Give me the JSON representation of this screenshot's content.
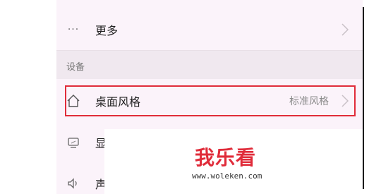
{
  "menu": {
    "more": {
      "icon": "more-dots-icon",
      "label": "更多",
      "dots": "···"
    },
    "section_device": "设备",
    "desktop_style": {
      "icon": "home-icon",
      "label": "桌面风格",
      "value": "标准风格"
    },
    "display": {
      "icon": "display-icon",
      "label": "显"
    },
    "sound": {
      "icon": "speaker-icon",
      "label": "声"
    }
  },
  "watermark": {
    "logo": "我乐看",
    "url": "www.woleken.com"
  },
  "colors": {
    "highlight": "#e02c3a",
    "panel_bg": "#fbf3fa",
    "section_bg": "#f0e8ef"
  }
}
